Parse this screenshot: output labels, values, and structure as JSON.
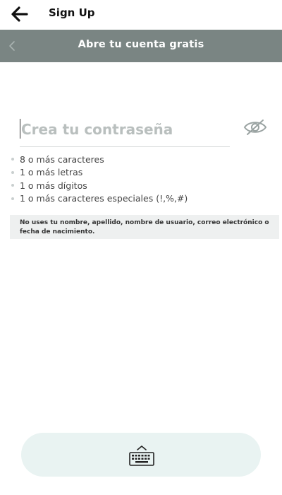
{
  "topbar": {
    "title": "Sign Up",
    "back_icon": "back-arrow-icon"
  },
  "header": {
    "title": "Abre tu cuenta gratis",
    "chevron_icon": "chevron-left-icon",
    "color": "#7a8583"
  },
  "password": {
    "value": "",
    "placeholder": "Crea tu contraseña",
    "visibility_icon": "eye-off-icon"
  },
  "requirements": [
    "8 o más caracteres",
    "1 o más letras",
    "1 o más dígitos",
    "1 o más caracteres especiales (!,%,#)"
  ],
  "notice": "No uses tu nombre, apellido, nombre de usuario, correo electrónico o fecha de nacimiento.",
  "keyboard_button": {
    "icon": "keyboard-icon",
    "color": "#e9f3f2"
  }
}
